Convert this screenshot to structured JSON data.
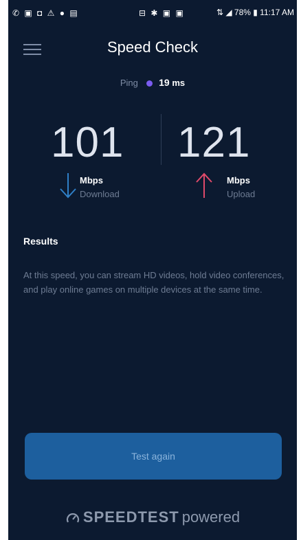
{
  "status_bar": {
    "left_icons": "✆ ▣ ◘ ⚠ ● ▤",
    "mid_icons": "⊟ ✱ ▣ ▣",
    "right_text": "⇅ ◢ 78% ▮ 11:17 AM"
  },
  "header": {
    "title": "Speed Check",
    "menu_icon": "hamburger-icon"
  },
  "ping": {
    "label": "Ping",
    "value": "19",
    "unit": "ms"
  },
  "download": {
    "value": "101",
    "unit": "Mbps",
    "label": "Download",
    "color": "#2f80c8"
  },
  "upload": {
    "value": "121",
    "unit": "Mbps",
    "label": "Upload",
    "color": "#e04a6a"
  },
  "results": {
    "heading": "Results",
    "body": "At this speed, you can stream HD videos, hold video conferences, and play online games on multiple devices at the same time."
  },
  "actions": {
    "test_again": "Test again"
  },
  "footer": {
    "brand": "SPEEDTEST",
    "suffix": "powered"
  },
  "colors": {
    "background": "#0c1a30",
    "button": "#1d5f9e",
    "ping_dot": "#7b5cf0"
  }
}
